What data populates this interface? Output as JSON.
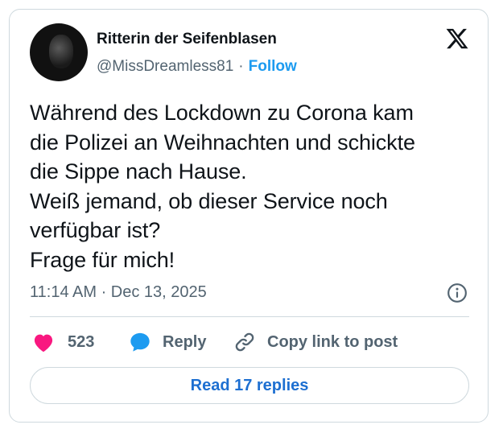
{
  "author": {
    "display_name": "Ritterin der Seifenblasen",
    "handle": "@MissDreamless81",
    "separator": "·",
    "follow_label": "Follow"
  },
  "tweet": {
    "text": "Während des Lockdown zu Corona kam\ndie Polizei an Weihnachten und schickte\ndie Sippe nach Hause.\nWeiß jemand, ob dieser Service noch\nverfügbar ist?\nFrage für mich!",
    "timestamp": "11:14 AM · Dec 13, 2025"
  },
  "actions": {
    "like_count": "523",
    "reply_label": "Reply",
    "copy_label": "Copy link to post"
  },
  "read_replies_label": "Read 17 replies",
  "icons": {
    "logo": "x-logo-icon",
    "info": "info-icon",
    "like": "heart-icon",
    "reply": "speech-bubble-icon",
    "copy": "link-icon"
  },
  "colors": {
    "accent": "#1d9bf0",
    "like": "#f91880",
    "muted": "#536471",
    "border": "#cfd9de"
  }
}
